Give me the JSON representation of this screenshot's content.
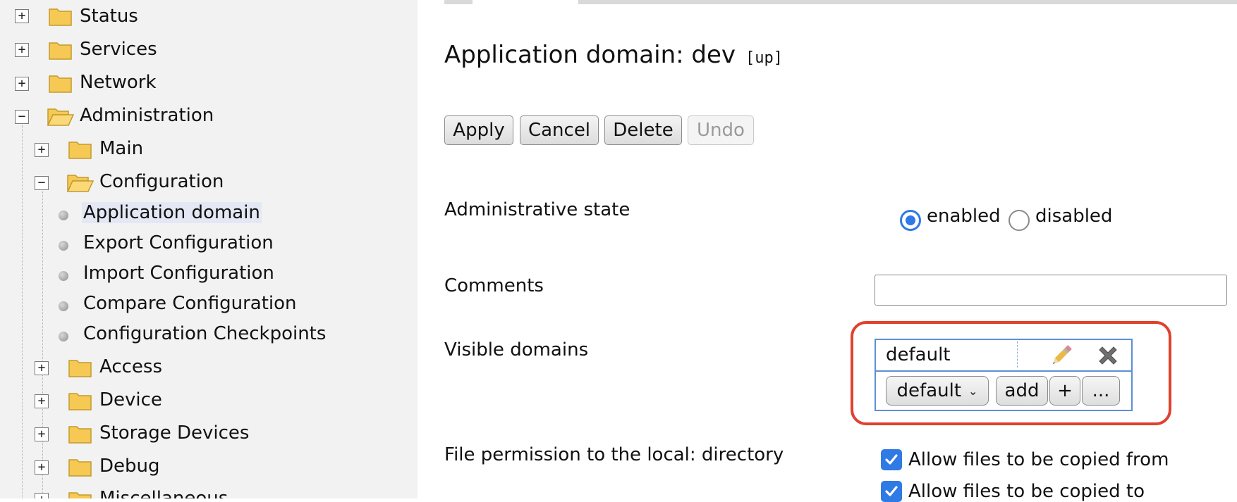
{
  "sidebar": {
    "top_items": [
      {
        "label": "Status",
        "expander": "+"
      },
      {
        "label": "Services",
        "expander": "+"
      },
      {
        "label": "Network",
        "expander": "+"
      },
      {
        "label": "Administration",
        "expander": "−"
      }
    ],
    "admin_children": [
      {
        "label": "Main",
        "expander": "+"
      },
      {
        "label": "Configuration",
        "expander": "−"
      }
    ],
    "configuration_leaves": [
      {
        "label": "Application domain",
        "selected": true
      },
      {
        "label": "Export Configuration"
      },
      {
        "label": "Import Configuration"
      },
      {
        "label": "Compare Configuration"
      },
      {
        "label": "Configuration Checkpoints"
      }
    ],
    "admin_more": [
      {
        "label": "Access",
        "expander": "+"
      },
      {
        "label": "Device",
        "expander": "+"
      },
      {
        "label": "Storage Devices",
        "expander": "+"
      },
      {
        "label": "Debug",
        "expander": "+"
      },
      {
        "label": "Miscellaneous",
        "expander": "+"
      }
    ],
    "icons": {
      "folder_closed": "folder-icon",
      "folder_open": "folder-open-icon",
      "leaf": "bullet-icon"
    },
    "folder_color": "#f6c955"
  },
  "main": {
    "title": "Application domain: dev",
    "status": "[up]",
    "buttons": {
      "apply": "Apply",
      "cancel": "Cancel",
      "delete": "Delete",
      "undo": "Undo"
    },
    "fields": {
      "admin_state": {
        "label": "Administrative state",
        "options": [
          "enabled",
          "disabled"
        ],
        "selected": "enabled"
      },
      "comments": {
        "label": "Comments",
        "value": ""
      },
      "visible_domains": {
        "label": "Visible domains",
        "entries": [
          "default"
        ],
        "select_value": "default",
        "add_label": "add",
        "plus_label": "+",
        "more_label": "..."
      },
      "file_permission": {
        "label": "File permission to the local: directory",
        "options": [
          {
            "label": "Allow files to be copied from",
            "checked": true
          },
          {
            "label": "Allow files to be copied to",
            "checked": true
          }
        ]
      }
    },
    "colors": {
      "accent": "#2f7ae5",
      "highlight": "#e0412f",
      "table_border": "#5d8fd6"
    }
  }
}
